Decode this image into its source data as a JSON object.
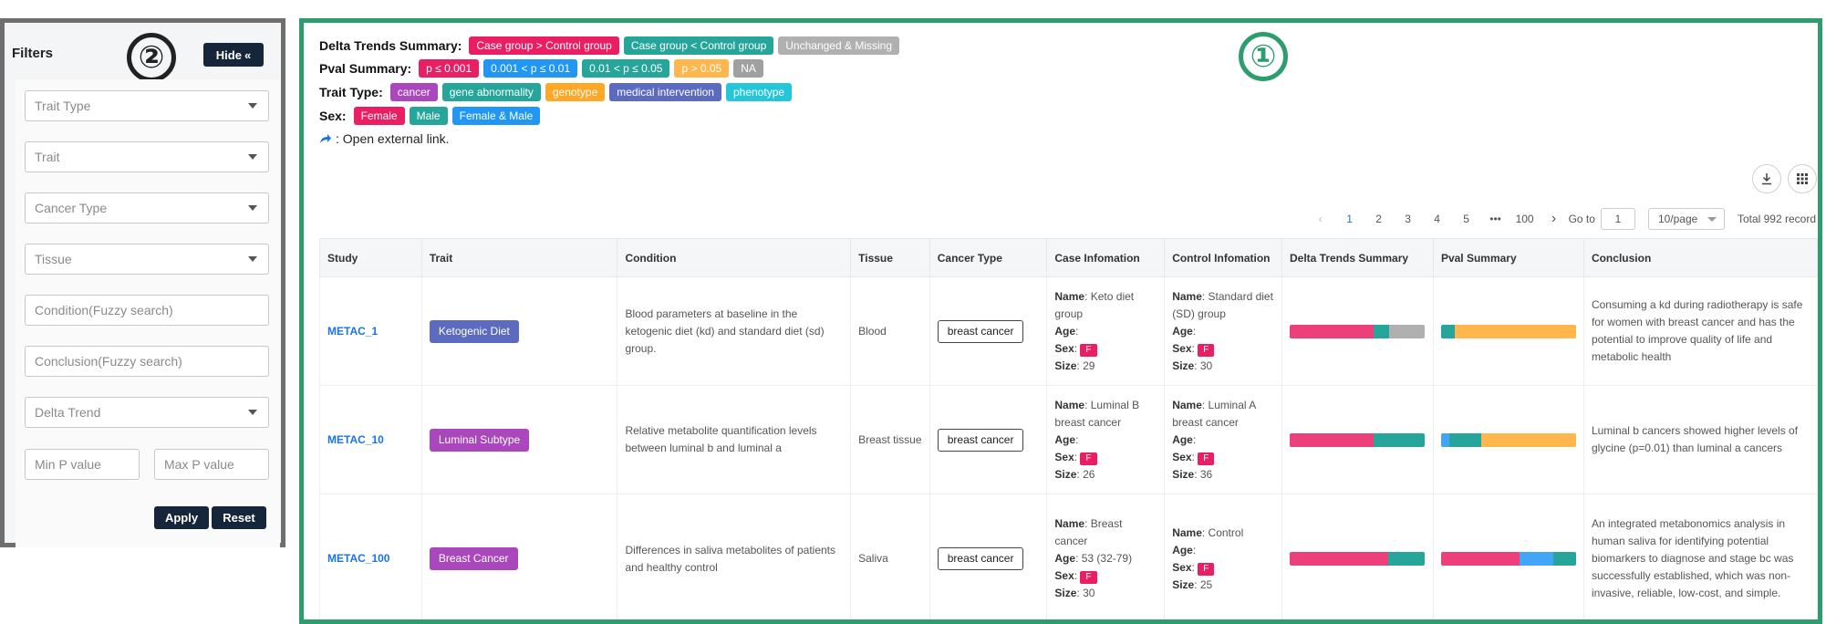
{
  "colors": {
    "filters_border": "#6e6e6e",
    "main_border": "#2e9d6e",
    "dark_button": "#15253a",
    "link": "#1a73e8"
  },
  "filters": {
    "title": "Filters",
    "callout": "②",
    "hide_label": "Hide",
    "hide_icon": "«",
    "fields": [
      {
        "placeholder": "Trait Type",
        "type": "select"
      },
      {
        "placeholder": "Trait",
        "type": "select"
      },
      {
        "placeholder": "Cancer Type",
        "type": "select"
      },
      {
        "placeholder": "Tissue",
        "type": "select"
      },
      {
        "placeholder": "Condition(Fuzzy search)",
        "type": "text"
      },
      {
        "placeholder": "Conclusion(Fuzzy search)",
        "type": "text"
      },
      {
        "placeholder": "Delta Trend",
        "type": "select"
      }
    ],
    "min_p_placeholder": "Min P value",
    "max_p_placeholder": "Max P value",
    "apply_label": "Apply",
    "reset_label": "Reset"
  },
  "main": {
    "callout": "①",
    "legend": {
      "delta": {
        "title": "Delta Trends Summary:",
        "tags": [
          {
            "label": "Case group > Control group",
            "color": "#e91e63"
          },
          {
            "label": "Case group < Control group",
            "color": "#26a69a"
          },
          {
            "label": "Unchanged & Missing",
            "color": "#b0b0b0"
          }
        ]
      },
      "pval": {
        "title": "Pval Summary:",
        "tags": [
          {
            "label": "p ≤ 0.001",
            "color": "#e91e63"
          },
          {
            "label": "0.001 < p ≤ 0.01",
            "color": "#2196f3"
          },
          {
            "label": "0.01 < p ≤ 0.05",
            "color": "#26a69a"
          },
          {
            "label": "p > 0.05",
            "color": "#ffb74d"
          },
          {
            "label": "NA",
            "color": "#a0a0a0"
          }
        ]
      },
      "trait_type": {
        "title": "Trait Type:",
        "tags": [
          {
            "label": "cancer",
            "color": "#ab47bc"
          },
          {
            "label": "gene abnormality",
            "color": "#26a69a"
          },
          {
            "label": "genotype",
            "color": "#ffa726"
          },
          {
            "label": "medical intervention",
            "color": "#5c6bc0"
          },
          {
            "label": "phenotype",
            "color": "#26c6da"
          }
        ]
      },
      "sex": {
        "title": "Sex:",
        "tags": [
          {
            "label": "Female",
            "color": "#e91e63"
          },
          {
            "label": "Male",
            "color": "#26a69a"
          },
          {
            "label": "Female & Male",
            "color": "#2196f3"
          }
        ]
      },
      "external_note": ": Open external link."
    },
    "toolbar": {
      "download_icon": "download-icon",
      "columns_icon": "grid-icon"
    },
    "pagination": {
      "prev": "‹",
      "pages": [
        "1",
        "2",
        "3",
        "4",
        "5"
      ],
      "ellipsis": "•••",
      "last": "100",
      "next": "›",
      "goto_label": "Go to",
      "goto_value": "1",
      "page_size": "10/page",
      "total": "Total 992 record"
    },
    "table": {
      "columns": [
        "Study",
        "Trait",
        "Condition",
        "Tissue",
        "Cancer Type",
        "Case Infomation",
        "Control Infomation",
        "Delta Trends Summary",
        "Pval Summary",
        "Conclusion"
      ],
      "labels": {
        "name": "Name",
        "age": "Age",
        "sex": "Sex",
        "size": "Size"
      },
      "rows": [
        {
          "study": "METAC_1",
          "trait": "Ketogenic Diet",
          "trait_color": "#5c6bc0",
          "condition": "Blood parameters at baseline in the ketogenic diet (kd) and standard diet (sd) group.",
          "tissue": "Blood",
          "cancer_type": "breast cancer",
          "case": {
            "name": "Keto diet group",
            "age": "",
            "sex": "F",
            "size": "29"
          },
          "control": {
            "name": "Standard diet (SD) group",
            "age": "",
            "sex": "F",
            "size": "30"
          },
          "delta": [
            {
              "color": "#ec407a",
              "frac": 0.62
            },
            {
              "color": "#26a69a",
              "frac": 0.12
            },
            {
              "color": "#b0b0b0",
              "frac": 0.26
            }
          ],
          "pval": [
            {
              "color": "#26a69a",
              "frac": 0.1
            },
            {
              "color": "#ffb74d",
              "frac": 0.9
            }
          ],
          "conclusion": "Consuming a kd during radiotherapy is safe for women with breast cancer and has the potential to improve quality of life and metabolic health"
        },
        {
          "study": "METAC_10",
          "trait": "Luminal Subtype",
          "trait_color": "#ab47bc",
          "condition": "Relative metabolite quantification levels between luminal b and luminal a",
          "tissue": "Breast tissue",
          "cancer_type": "breast cancer",
          "case": {
            "name": "Luminal B breast cancer",
            "age": "",
            "sex": "F",
            "size": "26"
          },
          "control": {
            "name": "Luminal A breast cancer",
            "age": "",
            "sex": "F",
            "size": "36"
          },
          "delta": [
            {
              "color": "#ec407a",
              "frac": 0.62
            },
            {
              "color": "#26a69a",
              "frac": 0.38
            }
          ],
          "pval": [
            {
              "color": "#42a5f5",
              "frac": 0.06
            },
            {
              "color": "#26a69a",
              "frac": 0.24
            },
            {
              "color": "#ffb74d",
              "frac": 0.7
            }
          ],
          "conclusion": "Luminal b cancers showed higher levels of glycine (p=0.01) than luminal a cancers"
        },
        {
          "study": "METAC_100",
          "trait": "Breast Cancer",
          "trait_color": "#ab47bc",
          "condition": "Differences in saliva metabolites of patients and healthy control",
          "tissue": "Saliva",
          "cancer_type": "breast cancer",
          "case": {
            "name": "Breast cancer",
            "age": "53 (32-79)",
            "sex": "F",
            "size": "30"
          },
          "control": {
            "name": "Control",
            "age": "",
            "sex": "F",
            "size": "25"
          },
          "delta": [
            {
              "color": "#ec407a",
              "frac": 0.73
            },
            {
              "color": "#26a69a",
              "frac": 0.27
            }
          ],
          "pval": [
            {
              "color": "#ec407a",
              "frac": 0.58
            },
            {
              "color": "#42a5f5",
              "frac": 0.25
            },
            {
              "color": "#26a69a",
              "frac": 0.17
            }
          ],
          "conclusion": "An integrated metabonomics analysis in human saliva for identifying potential biomarkers to diagnose and stage bc was successfully established, which was non-invasive, reliable, low-cost, and simple."
        }
      ]
    }
  }
}
